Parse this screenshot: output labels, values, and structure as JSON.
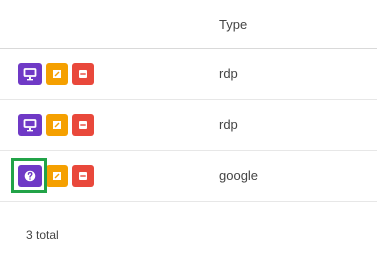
{
  "header": {
    "type_label": "Type"
  },
  "colors": {
    "purple": "#6f39c6",
    "orange": "#f5a000",
    "red": "#e9483b",
    "green": "#22a348",
    "divider": "#e7e7e7",
    "header_divider": "#d9d9d9"
  },
  "rows": [
    {
      "main_icon": "monitor-icon",
      "edit_icon": "edit-icon",
      "remove_icon": "minus-icon",
      "type": "rdp"
    },
    {
      "main_icon": "monitor-icon",
      "edit_icon": "edit-icon",
      "remove_icon": "minus-icon",
      "type": "rdp"
    },
    {
      "main_icon": "question-icon",
      "edit_icon": "edit-icon",
      "remove_icon": "minus-icon",
      "type": "google"
    }
  ],
  "footer": {
    "total_text": "3 total"
  }
}
